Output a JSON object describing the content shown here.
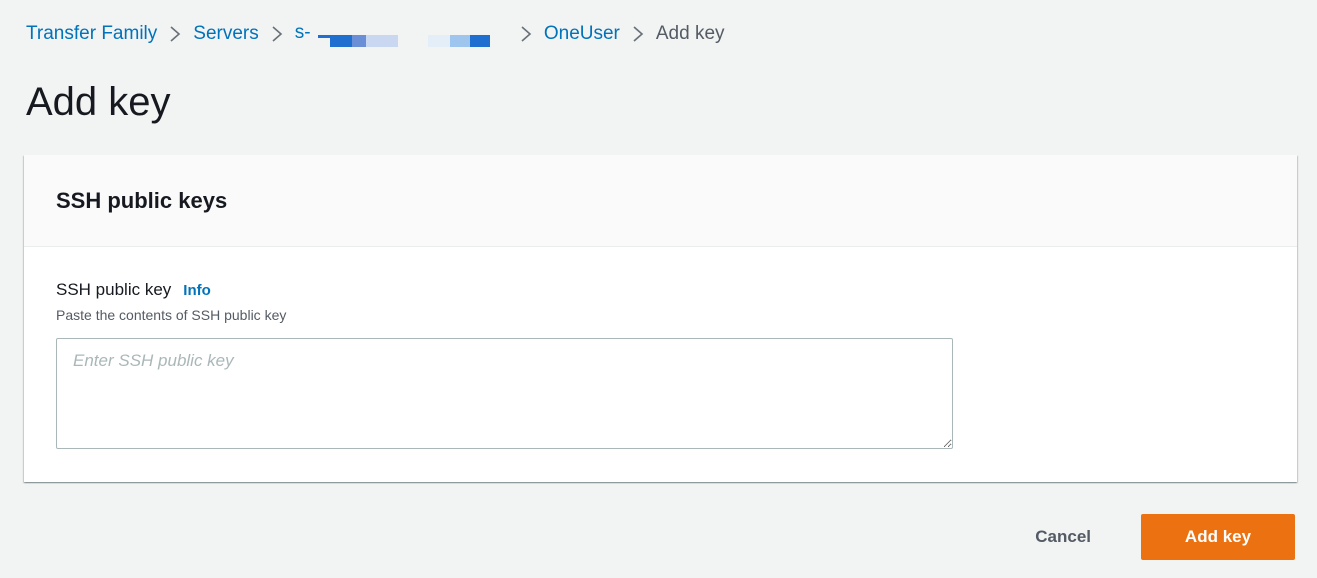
{
  "breadcrumb": {
    "items": [
      "Transfer Family",
      "Servers",
      "s-",
      "OneUser",
      "Add key"
    ],
    "redaction_colors": [
      "#1f6fd1",
      "#6b8fd6",
      "#c9d8f0",
      "#9ec5ee",
      "#1f6fd1"
    ]
  },
  "page": {
    "title": "Add key"
  },
  "panel": {
    "title": "SSH public keys",
    "field": {
      "label": "SSH public key",
      "info": "Info",
      "description": "Paste the contents of SSH public key",
      "placeholder": "Enter SSH public key",
      "value": ""
    }
  },
  "actions": {
    "cancel": "Cancel",
    "submit": "Add key"
  },
  "colors": {
    "link": "#0073bb",
    "primary": "#ec7211",
    "background": "#f2f3f3"
  }
}
